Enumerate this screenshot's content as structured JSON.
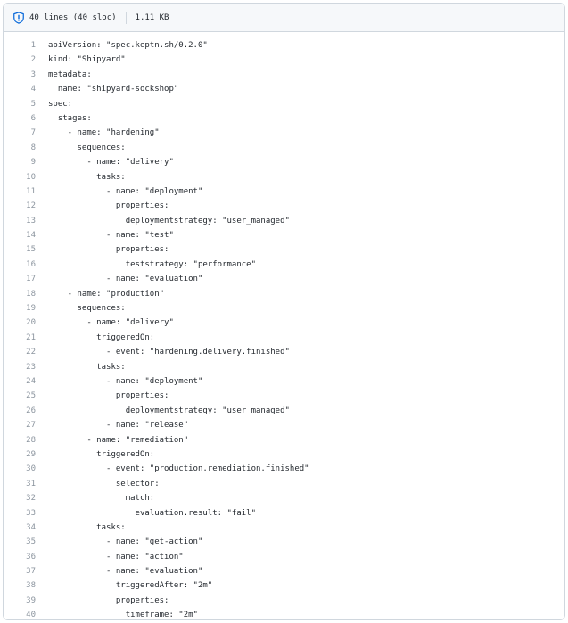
{
  "header": {
    "line_info": "40 lines (40 sloc)",
    "size": "1.11 KB"
  },
  "code_lines": [
    "apiVersion: \"spec.keptn.sh/0.2.0\"",
    "kind: \"Shipyard\"",
    "metadata:",
    "  name: \"shipyard-sockshop\"",
    "spec:",
    "  stages:",
    "    - name: \"hardening\"",
    "      sequences:",
    "        - name: \"delivery\"",
    "          tasks:",
    "            - name: \"deployment\"",
    "              properties:",
    "                deploymentstrategy: \"user_managed\"",
    "            - name: \"test\"",
    "              properties:",
    "                teststrategy: \"performance\"",
    "            - name: \"evaluation\"",
    "    - name: \"production\"",
    "      sequences:",
    "        - name: \"delivery\"",
    "          triggeredOn:",
    "            - event: \"hardening.delivery.finished\"",
    "          tasks:",
    "            - name: \"deployment\"",
    "              properties:",
    "                deploymentstrategy: \"user_managed\"",
    "            - name: \"release\"",
    "        - name: \"remediation\"",
    "          triggeredOn:",
    "            - event: \"production.remediation.finished\"",
    "              selector:",
    "                match:",
    "                  evaluation.result: \"fail\"",
    "          tasks:",
    "            - name: \"get-action\"",
    "            - name: \"action\"",
    "            - name: \"evaluation\"",
    "              triggeredAfter: \"2m\"",
    "              properties:",
    "                timeframe: \"2m\""
  ],
  "line_numbers": [
    "1",
    "2",
    "3",
    "4",
    "5",
    "6",
    "7",
    "8",
    "9",
    "10",
    "11",
    "12",
    "13",
    "14",
    "15",
    "16",
    "17",
    "18",
    "19",
    "20",
    "21",
    "22",
    "23",
    "24",
    "25",
    "26",
    "27",
    "28",
    "29",
    "30",
    "31",
    "32",
    "33",
    "34",
    "35",
    "36",
    "37",
    "38",
    "39",
    "40"
  ],
  "icons": {
    "header": "shield-icon"
  },
  "colors": {
    "accent": "#0969da",
    "line_number": "#8c959f",
    "text": "#24292f",
    "header_bg": "#f6f8fa",
    "border": "#d0d7de"
  }
}
